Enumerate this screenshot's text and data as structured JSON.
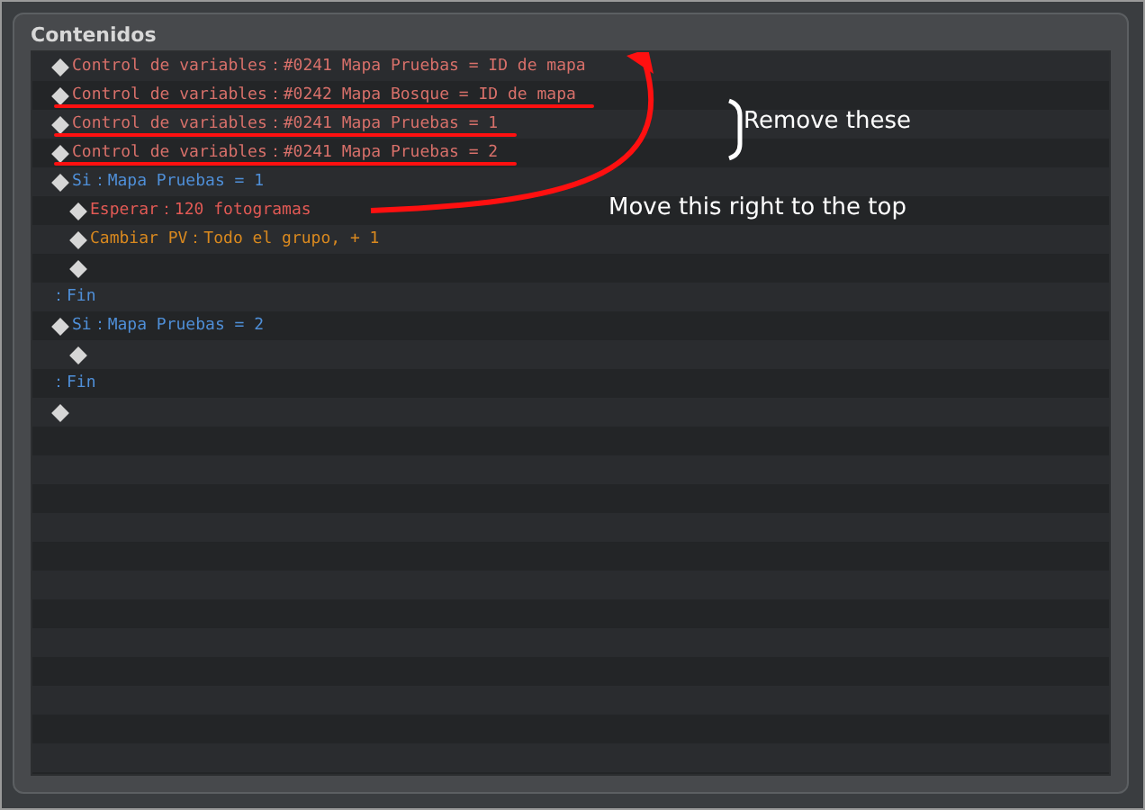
{
  "panel": {
    "title": "Contenidos"
  },
  "rows": [
    {
      "kind": "variable",
      "text": "Control de variables：#0241 Mapa Pruebas = ID de mapa",
      "struck": false
    },
    {
      "kind": "variable",
      "text": "Control de variables：#0242 Mapa Bosque = ID de mapa",
      "struck": true
    },
    {
      "kind": "variable",
      "text": "Control de variables：#0241 Mapa Pruebas = 1",
      "struck": true
    },
    {
      "kind": "variable",
      "text": "Control de variables：#0241 Mapa Pruebas = 2",
      "struck": true
    },
    {
      "kind": "branch",
      "text": "Si：Mapa Pruebas = 1",
      "struck": false,
      "children": [
        {
          "kind": "wait",
          "text": "Esperar：120 fotogramas",
          "struck": false
        },
        {
          "kind": "hp",
          "text": "Cambiar PV：Todo el grupo, + 1",
          "struck": false
        },
        {
          "kind": "empty",
          "struck": false
        }
      ]
    },
    {
      "kind": "end",
      "text": "：Fin",
      "struck": false
    },
    {
      "kind": "branch",
      "text": "Si：Mapa Pruebas = 2",
      "struck": false,
      "children": [
        {
          "kind": "empty",
          "struck": false
        }
      ]
    },
    {
      "kind": "end",
      "text": "：Fin",
      "struck": false
    },
    {
      "kind": "empty",
      "struck": false
    }
  ],
  "annotations": {
    "remove": "Remove these",
    "move": "Move this right to the top"
  }
}
